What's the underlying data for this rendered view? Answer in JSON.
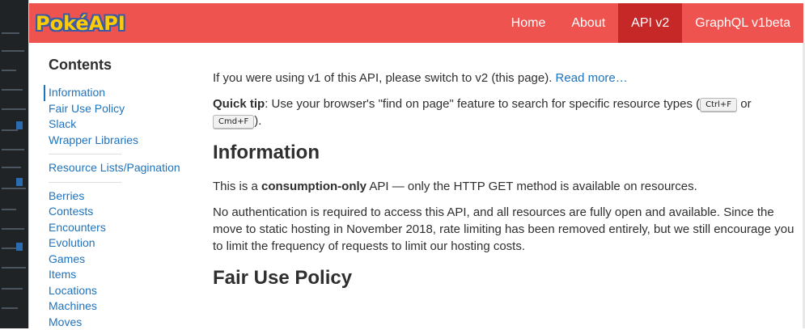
{
  "brand": {
    "logo_text": "PokéAPI"
  },
  "nav": {
    "items": [
      {
        "label": "Home"
      },
      {
        "label": "About"
      },
      {
        "label": "API v2"
      },
      {
        "label": "GraphQL v1beta"
      }
    ],
    "active": "API v2"
  },
  "sidebar": {
    "title": "Contents",
    "group1": [
      {
        "label": "Information"
      },
      {
        "label": "Fair Use Policy"
      },
      {
        "label": "Slack"
      },
      {
        "label": "Wrapper Libraries"
      }
    ],
    "group2": [
      {
        "label": "Resource Lists/Pagination"
      }
    ],
    "group3": [
      {
        "label": "Berries"
      },
      {
        "label": "Contests"
      },
      {
        "label": "Encounters"
      },
      {
        "label": "Evolution"
      },
      {
        "label": "Games"
      },
      {
        "label": "Items"
      },
      {
        "label": "Locations"
      },
      {
        "label": "Machines"
      },
      {
        "label": "Moves"
      }
    ]
  },
  "main": {
    "intro_text": "If you were using v1 of this API, please switch to v2 (this page). ",
    "intro_link": "Read more…",
    "tip_label": "Quick tip",
    "tip_text_1": ": Use your browser's \"find on page\" feature to search for specific resource types (",
    "tip_key_1": "Ctrl+F",
    "tip_or": " or",
    "tip_key_2": "Cmd+F",
    "tip_end": ").",
    "info_heading": "Information",
    "info_p1_pre": "This is a ",
    "info_p1_bold": "consumption-only",
    "info_p1_post": " API — only the HTTP GET method is available on resources.",
    "info_p2": "No authentication is required to access this API, and all resources are fully open and available. Since the move to static hosting in November 2018, rate limiting has been removed entirely, but we still encourage you to limit the frequency of requests to limit our hosting costs.",
    "fair_heading": "Fair Use Policy"
  }
}
